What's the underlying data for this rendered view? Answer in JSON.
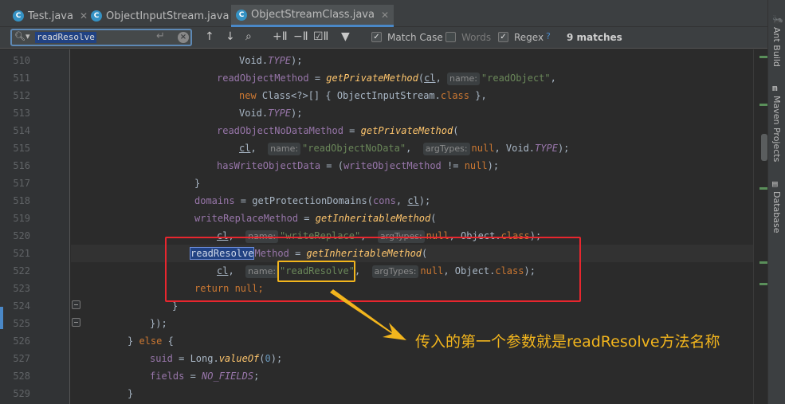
{
  "tabs": [
    {
      "label": "Test.java",
      "active": false
    },
    {
      "label": "ObjectInputStream.java",
      "active": false
    },
    {
      "label": "ObjectStreamClass.java",
      "active": true
    }
  ],
  "find": {
    "query": "readResolve",
    "options": [
      {
        "label": "Match Case",
        "checked": true
      },
      {
        "label": "Words",
        "checked": false
      },
      {
        "label": "Regex",
        "checked": true
      }
    ],
    "help": "?",
    "matches": "9 matches"
  },
  "lines": [
    "510",
    "511",
    "512",
    "513",
    "514",
    "515",
    "516",
    "517",
    "518",
    "519",
    "520",
    "521",
    "522",
    "523",
    "524",
    "525",
    "526",
    "527",
    "528",
    "529"
  ],
  "code": {
    "l510": {
      "a": "Void.",
      "b": "TYPE",
      "c": ");"
    },
    "l511": {
      "a": "readObjectMethod",
      "b": " = ",
      "c": "getPrivateMethod",
      "d": "(",
      "e": "cl",
      "f": ", ",
      "hint": "name:",
      "g": "\"readObject\"",
      "h": ","
    },
    "l512": {
      "a": "new ",
      "b": "Class<?>[] { ObjectInputStream.",
      "c": "class",
      "d": " },"
    },
    "l513": {
      "a": "Void.",
      "b": "TYPE",
      "c": ");"
    },
    "l514": {
      "a": "readObjectNoDataMethod",
      "b": " = ",
      "c": "getPrivateMethod",
      "d": "("
    },
    "l515": {
      "a": "cl",
      "b": ",  ",
      "hint1": "name:",
      "c": "\"readObjectNoData\"",
      "d": ",  ",
      "hint2": "argTypes:",
      "e": "null",
      "f": ", Void.",
      "g": "TYPE",
      "h": ");"
    },
    "l516": {
      "a": "hasWriteObjectData",
      "b": " = (",
      "c": "writeObjectMethod",
      "d": " != ",
      "e": "null",
      "f": ");"
    },
    "l517": {
      "a": "}"
    },
    "l518": {
      "a": "domains",
      "b": " = getProtectionDomains(",
      "c": "cons",
      "d": ", ",
      "e": "cl",
      "f": ");"
    },
    "l519": {
      "a": "writeReplaceMethod",
      "b": " = ",
      "c": "getInheritableMethod",
      "d": "("
    },
    "l520": {
      "a": "cl",
      "b": ",  ",
      "hint1": "name:",
      "c": "\"writeReplace\"",
      "d": ",  ",
      "hint2": "argTypes:",
      "e": "null",
      "f": ", Object.",
      "g": "class",
      "h": ");"
    },
    "l521": {
      "match": "readResolve",
      "a": "Method",
      "b": " = ",
      "c": "getInheritableMethod",
      "d": "("
    },
    "l522": {
      "a": "cl",
      "b": ",  ",
      "hint1": "name:",
      "c": "\"readResolve\"",
      "d": ",  ",
      "hint2": "argTypes:",
      "e": "null",
      "f": ", Object.",
      "g": "class",
      "h": ");"
    },
    "l523": {
      "a": "return ",
      "b": "null",
      "c": ";"
    },
    "l524": {
      "a": "}"
    },
    "l525": {
      "a": "});"
    },
    "l526": {
      "a": "} ",
      "b": "else",
      "c": " {"
    },
    "l527": {
      "a": "suid",
      "b": " = Long.",
      "c": "valueOf",
      "d": "(",
      "e": "0",
      "f": ");"
    },
    "l528": {
      "a": "fields",
      "b": " = ",
      "c": "NO_FIELDS",
      "d": ";"
    },
    "l529": {
      "a": "}"
    }
  },
  "annotation": {
    "text": "传入的第一个参数就是readResolve方法名称",
    "color": "#f2b51d",
    "box_color": "#e8262e"
  },
  "sidebar": [
    {
      "label": "Ant Build",
      "icon": "ant-icon"
    },
    {
      "label": "Maven Projects",
      "icon": "maven-icon"
    },
    {
      "label": "Database",
      "icon": "database-icon"
    }
  ]
}
